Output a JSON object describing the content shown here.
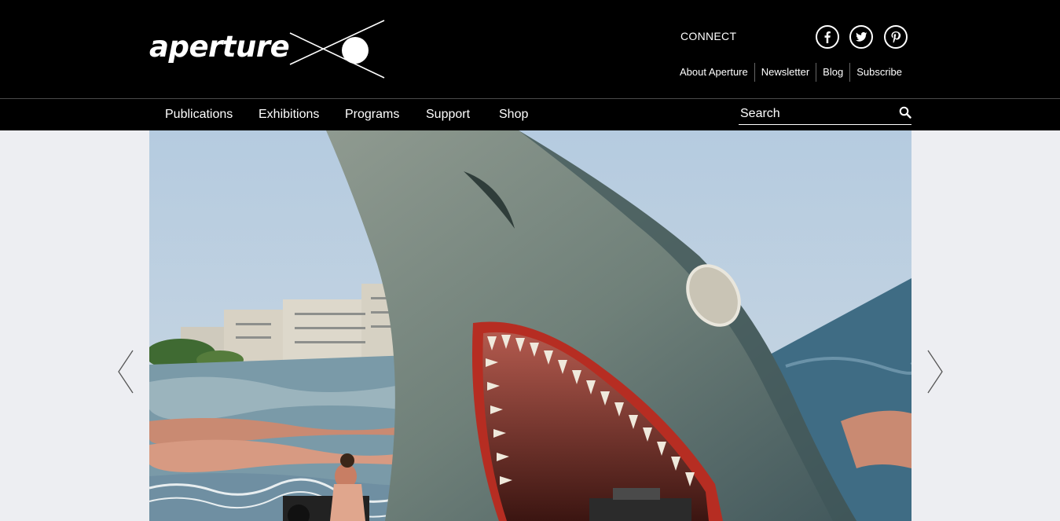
{
  "header": {
    "logo": "aperture",
    "connect_label": "CONNECT",
    "social": [
      "facebook-icon",
      "twitter-icon",
      "pinterest-icon"
    ],
    "links": [
      "About Aperture",
      "Newsletter",
      "Blog",
      "Subscribe"
    ]
  },
  "nav": {
    "items": [
      "Publications",
      "Exhibitions",
      "Programs",
      "Support",
      "Shop"
    ],
    "search_placeholder": "Search"
  },
  "colors": {
    "header_bg": "#000000",
    "page_bg": "#edeef2"
  }
}
